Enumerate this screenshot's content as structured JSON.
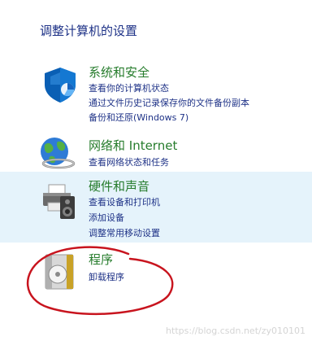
{
  "page": {
    "title": "调整计算机的设置"
  },
  "categories": [
    {
      "title": "系统和安全",
      "icon": "shield-icon",
      "links": [
        "查看你的计算机状态",
        "通过文件历史记录保存你的文件备份副本",
        "备份和还原(Windows 7)"
      ]
    },
    {
      "title": "网络和 Internet",
      "icon": "network-globe-icon",
      "links": [
        "查看网络状态和任务"
      ]
    },
    {
      "title": "硬件和声音",
      "icon": "printer-speaker-icon",
      "links": [
        "查看设备和打印机",
        "添加设备",
        "调整常用移动设置"
      ]
    },
    {
      "title": "程序",
      "icon": "programs-disc-icon",
      "links": [
        "卸载程序"
      ]
    }
  ],
  "annotation": {
    "color": "#c8141e"
  },
  "watermark": "https://blog.csdn.net/zy010101"
}
